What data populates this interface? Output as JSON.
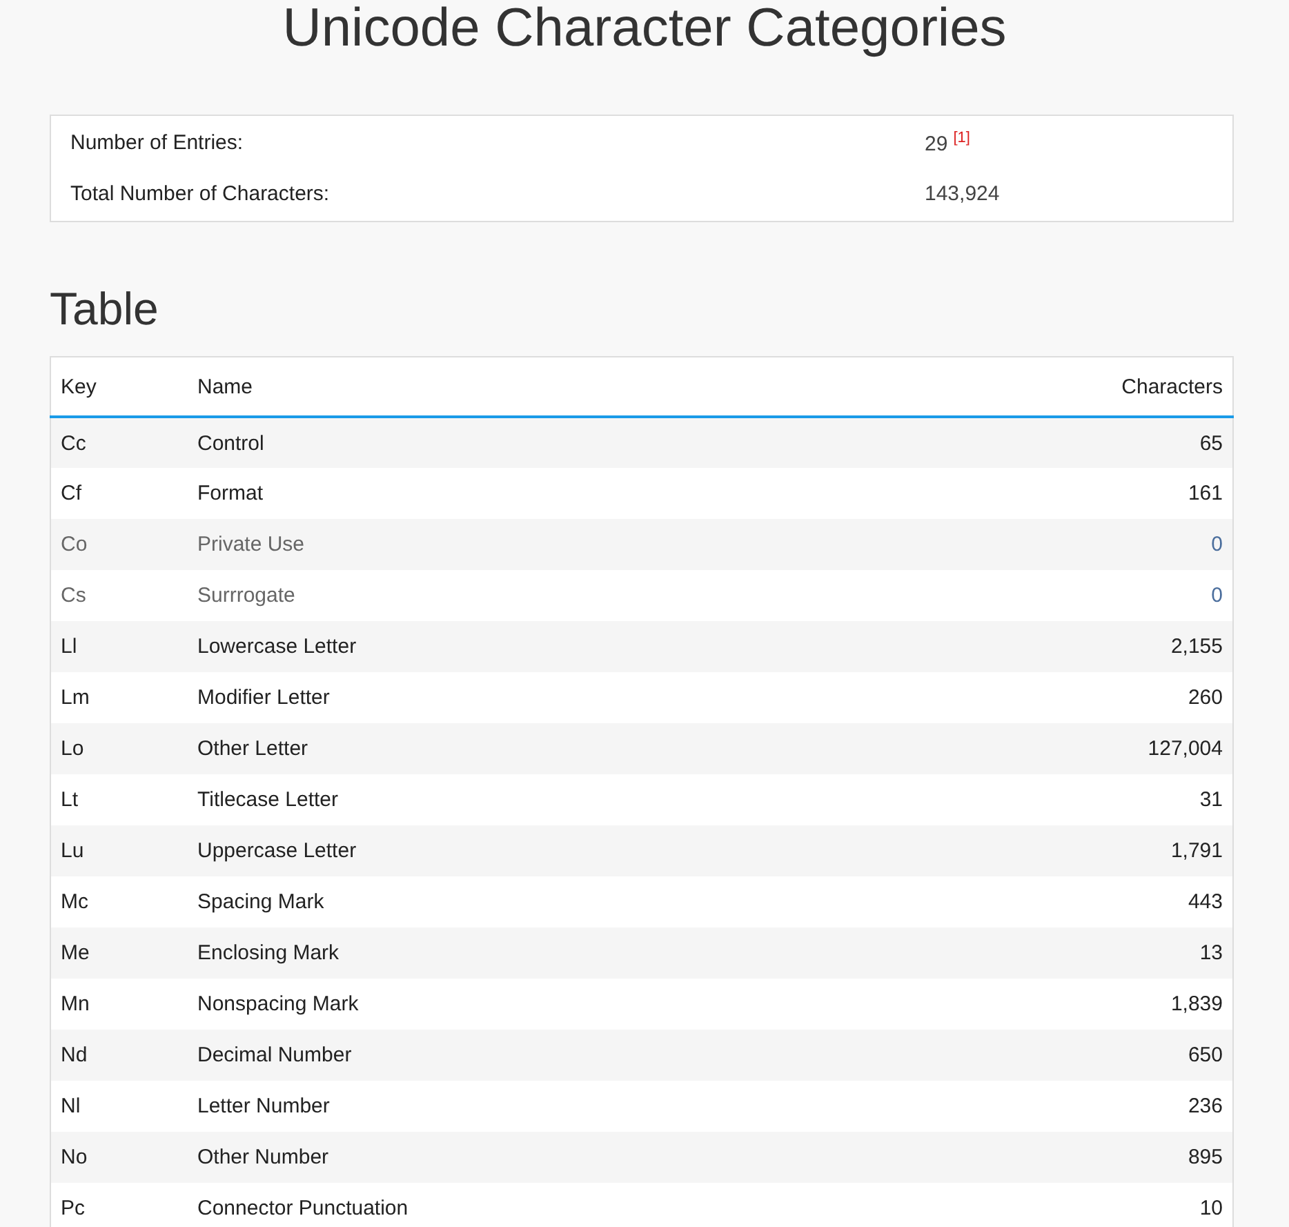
{
  "title": "Unicode Character Categories",
  "summary": [
    {
      "label": "Number of Entries:",
      "value": "29",
      "footnote": "[1]"
    },
    {
      "label": "Total Number of Characters:",
      "value": "143,924"
    }
  ],
  "section_heading": "Table",
  "table": {
    "columns": [
      "Key",
      "Name",
      "Characters"
    ],
    "rows": [
      {
        "key": "Cc",
        "name": "Control",
        "characters": "65",
        "disabled": false
      },
      {
        "key": "Cf",
        "name": "Format",
        "characters": "161",
        "disabled": false
      },
      {
        "key": "Co",
        "name": "Private Use",
        "characters": "0",
        "disabled": true
      },
      {
        "key": "Cs",
        "name": "Surrrogate",
        "characters": "0",
        "disabled": true
      },
      {
        "key": "Ll",
        "name": "Lowercase Letter",
        "characters": "2,155",
        "disabled": false
      },
      {
        "key": "Lm",
        "name": "Modifier Letter",
        "characters": "260",
        "disabled": false
      },
      {
        "key": "Lo",
        "name": "Other Letter",
        "characters": "127,004",
        "disabled": false
      },
      {
        "key": "Lt",
        "name": "Titlecase Letter",
        "characters": "31",
        "disabled": false
      },
      {
        "key": "Lu",
        "name": "Uppercase Letter",
        "characters": "1,791",
        "disabled": false
      },
      {
        "key": "Mc",
        "name": "Spacing Mark",
        "characters": "443",
        "disabled": false
      },
      {
        "key": "Me",
        "name": "Enclosing Mark",
        "characters": "13",
        "disabled": false
      },
      {
        "key": "Mn",
        "name": "Nonspacing Mark",
        "characters": "1,839",
        "disabled": false
      },
      {
        "key": "Nd",
        "name": "Decimal Number",
        "characters": "650",
        "disabled": false
      },
      {
        "key": "Nl",
        "name": "Letter Number",
        "characters": "236",
        "disabled": false
      },
      {
        "key": "No",
        "name": "Other Number",
        "characters": "895",
        "disabled": false
      },
      {
        "key": "Pc",
        "name": "Connector Punctuation",
        "characters": "10",
        "disabled": false
      }
    ]
  }
}
